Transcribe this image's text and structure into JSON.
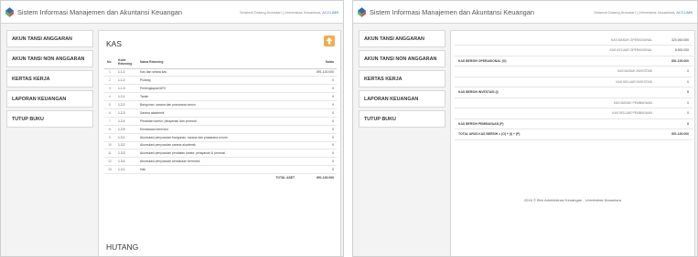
{
  "app": {
    "title": "Sistem Informasi Manajemen dan Akuntansi Keuangan",
    "welcome_text": "Selamat Datang Anandari | Universitas Nusantara",
    "user": "ACCLIMB"
  },
  "sidebar": {
    "items": [
      {
        "label": "AKUN TANSI ANGGARAN"
      },
      {
        "label": "AKUN TANSI NON ANGGARAN"
      },
      {
        "label": "KERTAS KERJA"
      },
      {
        "label": "LAPORAN KEUANGAN"
      },
      {
        "label": "TUTUP BUKU"
      }
    ]
  },
  "left": {
    "section_title": "KAS",
    "next_section_title": "HUTANG",
    "columns": {
      "no": "No",
      "code": "Kode Rekening",
      "name": "Nama Rekening",
      "balance": "Saldo"
    },
    "rows": [
      {
        "no": "1",
        "code": "1.1.1",
        "name": "Kas dan setara kas",
        "balance": "891.100.000"
      },
      {
        "no": "2",
        "code": "1.1.2",
        "name": "Piutang",
        "balance": "0"
      },
      {
        "no": "3",
        "code": "1.1.3",
        "name": "Perlengkapan/ATK",
        "balance": "0"
      },
      {
        "no": "4",
        "code": "1.2.1",
        "name": "Tanah",
        "balance": "0"
      },
      {
        "no": "5",
        "code": "1.2.2",
        "name": "Bangunan, sarana dan prasarana umum",
        "balance": "0"
      },
      {
        "no": "6",
        "code": "1.2.3",
        "name": "Sarana akademik",
        "balance": "0"
      },
      {
        "no": "7",
        "code": "1.2.4",
        "name": "Peralatan kantor, pelayanan dan promosi",
        "balance": "0"
      },
      {
        "no": "8",
        "code": "1.2.5",
        "name": "Kendaraan bermotor",
        "balance": "0"
      },
      {
        "no": "9",
        "code": "1.3.1",
        "name": "Akumulasi penyusutan bangunan, sarana dan prasarana umum",
        "balance": "0"
      },
      {
        "no": "10",
        "code": "1.3.2",
        "name": "Akumulasi penyusutan sarana akademik",
        "balance": "0"
      },
      {
        "no": "11",
        "code": "1.3.3",
        "name": "Akumulasi penyusutan peralatan kantor, pelayanan & promosi",
        "balance": "0"
      },
      {
        "no": "12",
        "code": "1.3.4",
        "name": "Akumulasi penyusutan kendaraan bermotor",
        "balance": "0"
      },
      {
        "no": "13",
        "code": "1.4.1",
        "name": "Hak",
        "balance": "0"
      }
    ],
    "total_label": "TOTAL ASET",
    "total_value": "891.100.000"
  },
  "right": {
    "rows": [
      {
        "label": "KAS MASUK OPERASIONAL",
        "value": "320.000.000",
        "type": "sub"
      },
      {
        "label": "KAS KELUAR OPERASIONAL",
        "value": "8.900.000",
        "type": "sub"
      },
      {
        "label": "KAS BERSIH OPERASIONAL (O)",
        "value": "891.100.000",
        "type": "head"
      },
      {
        "label": "KAS MASUK INVESTASI",
        "value": "0",
        "type": "sub"
      },
      {
        "label": "KAS KELUAR INVESTASI",
        "value": "0",
        "type": "sub"
      },
      {
        "label": "KAS BERSIH INVESTASI (I)",
        "value": "0",
        "type": "head"
      },
      {
        "label": "KAS MASUK PEMBIAYAAN",
        "value": "0",
        "type": "sub"
      },
      {
        "label": "KAS KELUAR PEMBIAYAAN",
        "value": "0",
        "type": "sub"
      },
      {
        "label": "KAS BERSIH PEMBIAYAAN (P)",
        "value": "0",
        "type": "head"
      },
      {
        "label": "TOTAL ARUS KAS BERSIH = (O) + (I) + (P)",
        "value": "891.100.000",
        "type": "head"
      }
    ],
    "footer": "2016 © Biro Administrasi Keuangan - Universitas Nusantara"
  },
  "colors": {
    "accent": "#f0ad4e",
    "logo_blue": "#2a6db5",
    "logo_red": "#d9534f",
    "logo_green": "#5cb85c"
  },
  "icons": {
    "logo": "university-logo-icon",
    "add": "add-upload-icon"
  }
}
